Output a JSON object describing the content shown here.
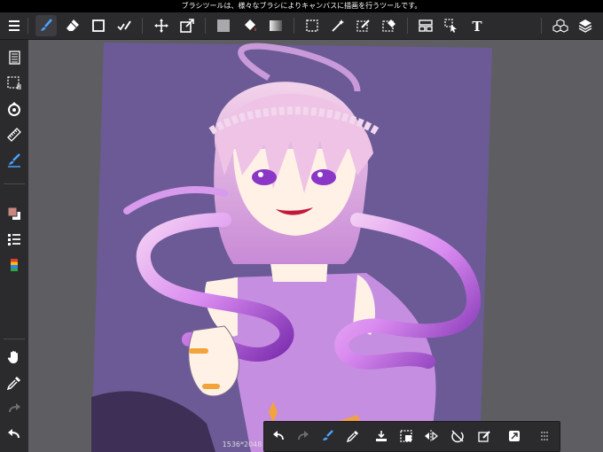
{
  "status_bar": {
    "message": "ブラシツールは、様々なブラシによりキャンバスに描画を行うツールです。"
  },
  "toolbar": {
    "items": [
      {
        "name": "menu-icon",
        "active": false
      },
      {
        "name": "brush-icon",
        "active": true
      },
      {
        "name": "eraser-icon",
        "active": false
      },
      {
        "name": "shape-icon",
        "active": false
      },
      {
        "name": "fill-paint-icon",
        "active": false
      },
      {
        "name": "move-icon",
        "active": false
      },
      {
        "name": "transform-icon",
        "active": false
      },
      {
        "name": "fill-color-icon",
        "active": false
      },
      {
        "name": "bucket-icon",
        "active": false
      },
      {
        "name": "gradient-icon",
        "active": false
      },
      {
        "name": "select-rect-icon",
        "active": false
      },
      {
        "name": "magic-wand-icon",
        "active": false
      },
      {
        "name": "select-pen-icon",
        "active": false
      },
      {
        "name": "select-eraser-icon",
        "active": false
      },
      {
        "name": "frame-divider-icon",
        "active": false
      },
      {
        "name": "operation-icon",
        "active": false
      },
      {
        "name": "text-icon",
        "active": false
      },
      {
        "name": "material-icon",
        "active": false
      },
      {
        "name": "layers-icon",
        "active": false
      }
    ],
    "text_tool_glyph": "T"
  },
  "sidebar": {
    "items": [
      "page-manager-icon",
      "selection-icon",
      "snap-icon",
      "ruler-icon",
      "brush-settings-icon",
      "color-swatch-icon",
      "brush-list-icon",
      "palette-icon",
      "hand-icon",
      "eyedropper-icon",
      "redo-icon",
      "undo-icon"
    ]
  },
  "canvas": {
    "dimensions": "1536*2048",
    "colors": {
      "background": "#6b5a96",
      "hair": "#e8b9de",
      "hair_shadow": "#9b5bbd",
      "tentacle": "#d787f0",
      "skin": "#fff1e6",
      "dress": "#c68ee0",
      "ring": "#f2a33a",
      "mouth": "#c2183a",
      "eye": "#8a36c7"
    }
  },
  "bottom_toolbar": {
    "items": [
      "undo-icon",
      "redo-icon",
      "brush-settings-icon",
      "eyedropper-icon",
      "fill-down-icon",
      "clear-icon",
      "flip-horizontal-icon",
      "rotate-reset-icon",
      "edit-selection-icon",
      "fullscreen-icon",
      "grip-icon"
    ]
  }
}
